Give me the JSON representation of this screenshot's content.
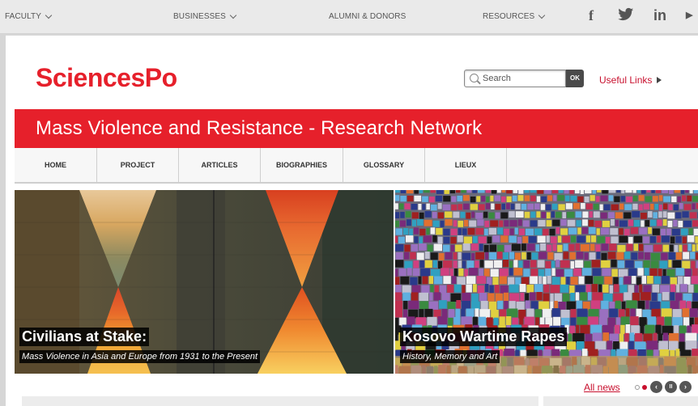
{
  "topbar": {
    "links": [
      {
        "label": "FACULTY",
        "has_dropdown": true
      },
      {
        "label": "BUSINESSES",
        "has_dropdown": true
      },
      {
        "label": "ALUMNI & DONORS",
        "has_dropdown": false
      },
      {
        "label": "RESOURCES",
        "has_dropdown": true
      }
    ],
    "social": [
      {
        "icon": "facebook-icon",
        "glyph": "f"
      },
      {
        "icon": "twitter-icon",
        "glyph": "🐦"
      },
      {
        "icon": "linkedin-icon",
        "glyph": "in"
      },
      {
        "icon": "youtube-icon",
        "glyph": "▶"
      }
    ]
  },
  "header": {
    "logo": "SciencesPo",
    "search_placeholder": "Search",
    "search_button": "OK",
    "useful_links": "Useful Links"
  },
  "banner": {
    "title": "Mass Violence and Resistance - Research Network"
  },
  "nav": {
    "items": [
      "HOME",
      "PROJECT",
      "ARTICLES",
      "BIOGRAPHIES",
      "GLOSSARY",
      "LIEUX"
    ]
  },
  "slides": [
    {
      "title": "Civilians at Stake:",
      "subtitle": "Mass Violence in Asia and Europe from 1931 to the Present"
    },
    {
      "title": "Kosovo Wartime Rapes",
      "subtitle": "History, Memory and Art"
    }
  ],
  "carousel": {
    "all_news": "All news",
    "controls": {
      "prev": "‹",
      "pause": "II",
      "next": "›"
    }
  },
  "colors": {
    "brand_red": "#e6202b",
    "link_red": "#c8102e"
  }
}
